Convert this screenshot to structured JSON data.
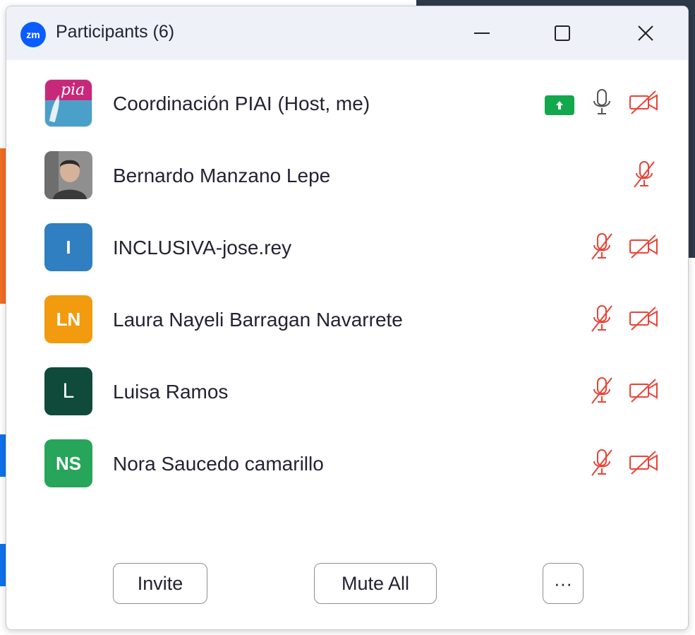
{
  "window": {
    "title": "Participants (6)",
    "app_icon_text": "zm",
    "accent_color": "#0b5cff"
  },
  "participants": [
    {
      "name": "Coordinación PIAI (Host, me)",
      "avatar": "image",
      "avatar_text": "pia",
      "sharing": true,
      "mic": "on",
      "video": "off"
    },
    {
      "name": "Bernardo Manzano Lepe",
      "avatar": "photo",
      "mic": "muted",
      "video": "none"
    },
    {
      "name": "INCLUSIVA-jose.rey",
      "avatar_text": "I",
      "avatar_color": "#2f7fc1",
      "mic": "muted",
      "video": "off"
    },
    {
      "name": "Laura Nayeli Barragan Navarrete",
      "avatar_text": "LN",
      "avatar_color": "#f29b0e",
      "mic": "muted",
      "video": "off"
    },
    {
      "name": "Luisa Ramos",
      "avatar_text": "L",
      "avatar_color": "#0f4a3a",
      "mic": "muted",
      "video": "off"
    },
    {
      "name": "Nora Saucedo camarillo",
      "avatar_text": "NS",
      "avatar_color": "#27a55a",
      "mic": "muted",
      "video": "off"
    }
  ],
  "footer": {
    "invite_label": "Invite",
    "mute_all_label": "Mute All",
    "more_label": "···"
  },
  "colors": {
    "muted_red": "#e8443a",
    "share_green": "#12a84b"
  }
}
